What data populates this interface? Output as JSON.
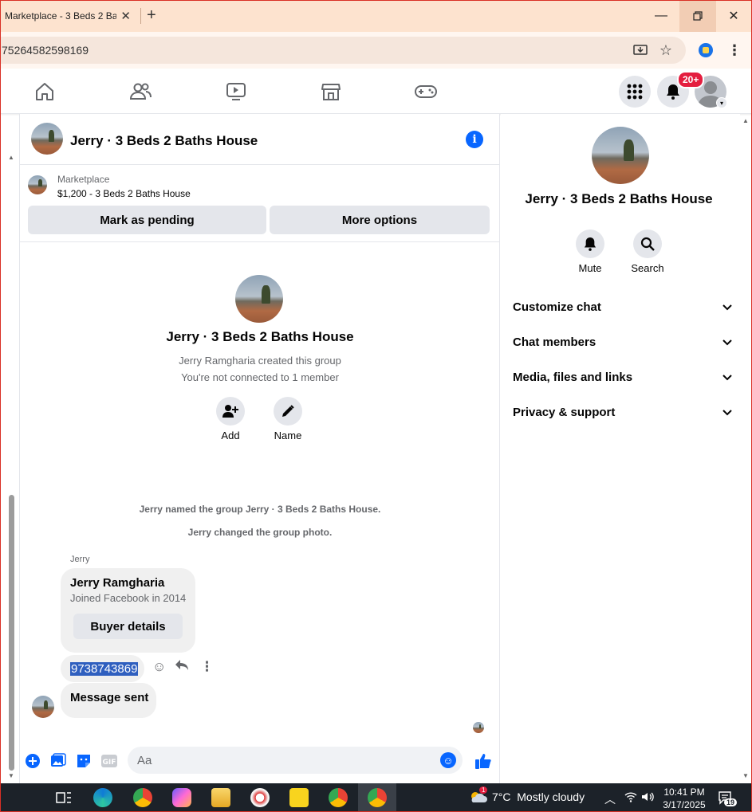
{
  "browser": {
    "tab_title": "Marketplace - 3 Beds 2 Ba",
    "url": "75264582598169"
  },
  "fb_nav": {
    "notification_count": "20+"
  },
  "chat": {
    "title": "Jerry · 3 Beds 2 Baths House",
    "listing": {
      "label": "Marketplace",
      "title": "$1,200 - 3 Beds 2 Baths House",
      "mark_pending": "Mark as pending",
      "more_options": "More options"
    },
    "intro": {
      "title": "Jerry · 3 Beds 2 Baths House",
      "created_by": "Jerry Ramgharia created this group",
      "connection": "You're not connected to 1 member",
      "add_label": "Add",
      "name_label": "Name"
    },
    "system_messages": [
      "Jerry named the group Jerry · 3 Beds 2 Baths House.",
      "Jerry changed the group photo."
    ],
    "sender_name": "Jerry",
    "buyer_card": {
      "name": "Jerry Ramgharia",
      "subtitle": "Joined Facebook in 2014",
      "button": "Buyer details"
    },
    "phone_message": "9738743869",
    "sent_message": "Message sent",
    "composer_placeholder": "Aa"
  },
  "details": {
    "title": "Jerry · 3 Beds 2 Baths House",
    "mute_label": "Mute",
    "search_label": "Search",
    "sections": [
      "Customize chat",
      "Chat members",
      "Media, files and links",
      "Privacy & support"
    ]
  },
  "taskbar": {
    "weather_badge": "1",
    "weather": "7°C  Mostly cloudy",
    "time": "10:41 PM",
    "date": "3/17/2025",
    "notif_count": "19"
  },
  "colors": {
    "accent": "#0866ff",
    "badge": "#e41e3f",
    "selection": "#2f5fbf"
  }
}
